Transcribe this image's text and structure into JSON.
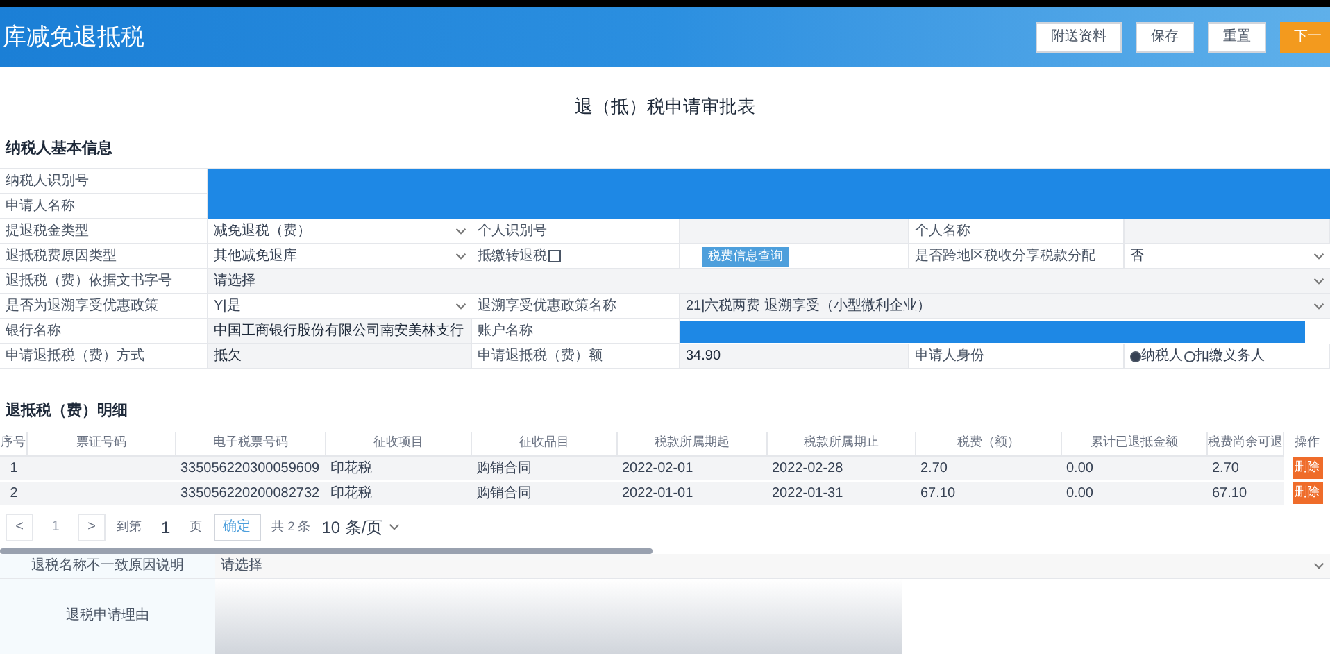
{
  "header": {
    "title": "库减免退抵税",
    "buttons": [
      {
        "label": "附送资料",
        "kind": "default"
      },
      {
        "label": "保存",
        "kind": "default"
      },
      {
        "label": "重置",
        "kind": "default"
      },
      {
        "label": "下一",
        "kind": "primary"
      }
    ]
  },
  "form_title": "退（抵）税申请审批表",
  "basic_info": {
    "heading": "纳税人基本信息",
    "rows": [
      [
        {
          "kind": "label",
          "text": "纳税人识别号"
        },
        {
          "kind": "redacted"
        }
      ],
      [
        {
          "kind": "label",
          "text": "申请人名称"
        },
        {
          "kind": "redacted"
        }
      ],
      [
        {
          "kind": "label",
          "text": "提退税金类型"
        },
        {
          "kind": "select",
          "text": "减免退税（费）"
        },
        {
          "kind": "label",
          "text": "个人识别号"
        },
        {
          "kind": "text",
          "text": ""
        },
        {
          "kind": "label",
          "text": "个人名称"
        },
        {
          "kind": "text",
          "text": ""
        }
      ],
      [
        {
          "kind": "label",
          "text": "退抵税费原因类型"
        },
        {
          "kind": "select",
          "text": "其他减免退库"
        },
        {
          "kind": "checkbox",
          "text": "抵缴转退税",
          "checked": false
        },
        {
          "kind": "button",
          "text": "税费信息查询"
        },
        {
          "kind": "label",
          "text": "是否跨地区税收分享税款分配"
        },
        {
          "kind": "select",
          "text": "否"
        }
      ],
      [
        {
          "kind": "label",
          "text": "退抵税（费）依据文书字号"
        },
        {
          "kind": "select_wide",
          "text": "请选择"
        }
      ],
      [
        {
          "kind": "label",
          "text": "是否为退溯享受优惠政策"
        },
        {
          "kind": "select",
          "text": "Y|是"
        },
        {
          "kind": "label",
          "text": "退溯享受优惠政策名称"
        },
        {
          "kind": "select_wide",
          "text": "21|六税两费 退溯享受（小型微利企业）"
        }
      ],
      [
        {
          "kind": "label",
          "text": "银行名称"
        },
        {
          "kind": "text",
          "text": "中国工商银行股份有限公司南安美林支行"
        },
        {
          "kind": "label",
          "text": "账户名称"
        },
        {
          "kind": "redacted"
        }
      ],
      [
        {
          "kind": "label",
          "text": "申请退抵税（费）方式"
        },
        {
          "kind": "text",
          "text": "抵欠"
        },
        {
          "kind": "label",
          "text": "申请退抵税（费）额"
        },
        {
          "kind": "text",
          "text": "34.90"
        },
        {
          "kind": "label",
          "text": "申请人身份"
        },
        {
          "kind": "radio",
          "options": [
            {
              "label": "纳税人",
              "selected": true
            },
            {
              "label": "扣缴义务人",
              "selected": false
            }
          ]
        }
      ]
    ]
  },
  "detail": {
    "heading": "退抵税（费）明细",
    "columns": [
      "序号",
      "票证号码",
      "电子税票号码",
      "征收项目",
      "征收品目",
      "税款所属期起",
      "税款所属期止",
      "税费（额）",
      "累计已退抵金额",
      "税费尚余可退",
      "操作"
    ],
    "rows": [
      {
        "cells": [
          "1",
          "",
          "335056220300059609",
          "印花税",
          "购销合同",
          "2022-02-01",
          "2022-02-28",
          "2.70",
          "0.00",
          "2.70"
        ],
        "action": "删除"
      },
      {
        "cells": [
          "2",
          "",
          "335056220200082732",
          "印花税",
          "购销合同",
          "2022-01-01",
          "2022-01-31",
          "67.10",
          "0.00",
          "67.10"
        ],
        "action": "删除"
      }
    ]
  },
  "pagination": {
    "prev": "<",
    "page": "1",
    "next": ">",
    "goto_label": "到第",
    "goto_value": "1",
    "page_unit": "页",
    "confirm": "确定",
    "total": "共 2 条",
    "page_size": "10 条/页"
  },
  "extra": [
    {
      "kind": "select",
      "label": "退税名称不一致原因说明",
      "value": "请选择"
    },
    {
      "kind": "textarea",
      "label": "退税申请理由"
    }
  ]
}
